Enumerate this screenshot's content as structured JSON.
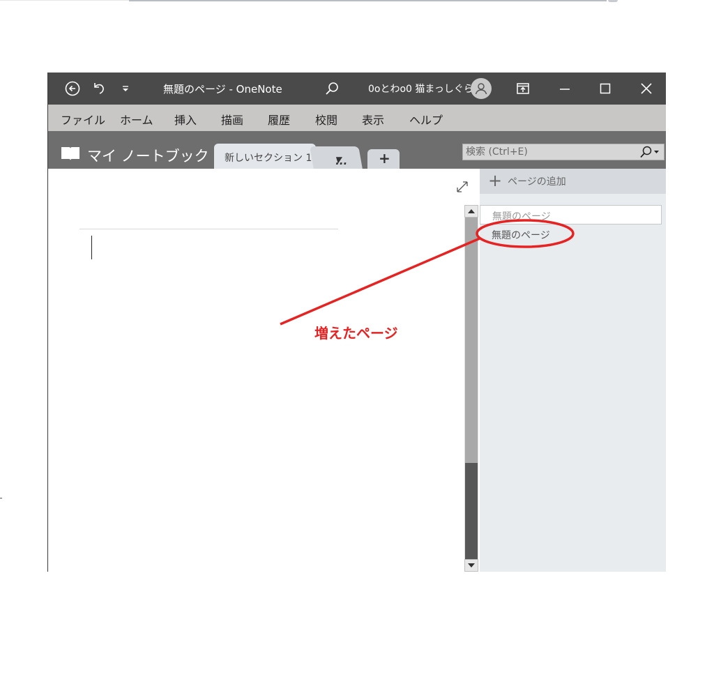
{
  "titlebar": {
    "title": "無題のページ  -  OneNote",
    "user_name": "0oとわo0 猫まっしぐら"
  },
  "menubar": {
    "items": [
      "ファイル",
      "ホーム",
      "挿入",
      "描画",
      "履歴",
      "校閲",
      "表示",
      "ヘルプ"
    ]
  },
  "navbar": {
    "notebook_name": "マイ ノートブック",
    "section_tab": "新しいセクション 1",
    "more_tabs": "...",
    "add_tab": "+",
    "search_placeholder": "検索 (Ctrl+E)"
  },
  "pages_pane": {
    "add_page_label": "ページの追加",
    "pages": [
      "無題のページ",
      "無題のページ"
    ]
  },
  "annotation": {
    "label": "増えたページ",
    "color": "#e52323"
  },
  "colors": {
    "titlebar": "#4a4a4a",
    "menubar": "#c9c7c5",
    "navbar": "#6e6e6e",
    "pane": "#e9ecef"
  }
}
